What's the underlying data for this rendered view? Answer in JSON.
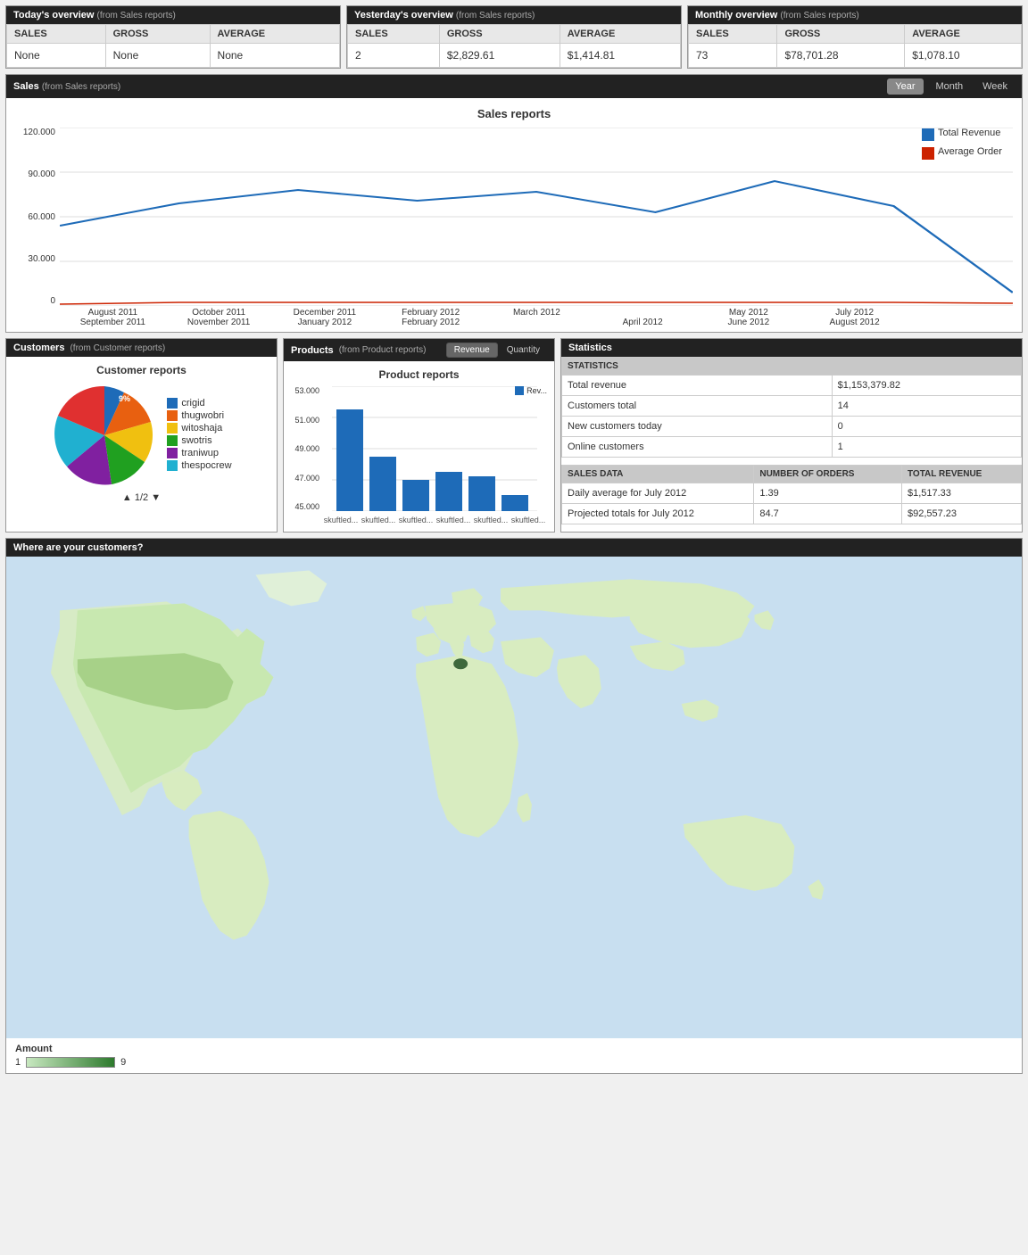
{
  "overviews": [
    {
      "title": "Today's overview",
      "source": "(from Sales reports)",
      "cols": [
        "SALES",
        "GROSS",
        "AVERAGE"
      ],
      "values": [
        "None",
        "None",
        "None"
      ]
    },
    {
      "title": "Yesterday's overview",
      "source": "(from Sales reports)",
      "cols": [
        "SALES",
        "GROSS",
        "AVERAGE"
      ],
      "values": [
        "2",
        "$2,829.61",
        "$1,414.81"
      ]
    },
    {
      "title": "Monthly overview",
      "source": "(from Sales reports)",
      "cols": [
        "SALES",
        "GROSS",
        "AVERAGE"
      ],
      "values": [
        "73",
        "$78,701.28",
        "$1,078.10"
      ]
    }
  ],
  "sales": {
    "title": "Sales",
    "source": "(from Sales reports)",
    "chartTitle": "Sales reports",
    "periods": [
      "Year",
      "Month",
      "Week"
    ],
    "activePeriod": "Year",
    "legend": [
      {
        "label": "Total Revenue",
        "color": "#1e6bb8"
      },
      {
        "label": "Average Order",
        "color": "#cc2200"
      }
    ],
    "xLabels": [
      [
        "August 2011",
        "September 2011"
      ],
      [
        "October 2011",
        "November 2011"
      ],
      [
        "December 2011",
        "January 2012"
      ],
      [
        "February 2012",
        "February 2012"
      ],
      [
        "March 2012",
        ""
      ],
      [
        "April 2012",
        ""
      ],
      [
        "May 2012",
        "June 2012"
      ],
      [
        "July 2012",
        "August 2012"
      ]
    ],
    "yLabels": [
      "120.000",
      "90.000",
      "60.000",
      "30.000",
      "0"
    ]
  },
  "customers": {
    "title": "Customers",
    "source": "(from Customer reports)",
    "chartTitle": "Customer reports",
    "pieData": [
      {
        "label": "crigid",
        "color": "#1e6bb8",
        "pct": 9
      },
      {
        "label": "thugwobri",
        "color": "#e86010"
      },
      {
        "label": "witoshaja",
        "color": "#f0c010"
      },
      {
        "label": "swotris",
        "color": "#20a020"
      },
      {
        "label": "traniwup",
        "color": "#8020a0"
      },
      {
        "label": "thespocrew",
        "color": "#20b0d0"
      }
    ],
    "pageIndicator": "1/2"
  },
  "products": {
    "title": "Products",
    "source": "(from Product reports)",
    "chartTitle": "Product reports",
    "activeView": "Revenue",
    "views": [
      "Revenue",
      "Quantity"
    ],
    "legendLabel": "Rev...",
    "legendColor": "#1e6bb8",
    "yLabels": [
      "53.000",
      "51.000",
      "49.000",
      "47.000",
      "45.000"
    ],
    "bars": [
      {
        "label": "skuftled...",
        "value": 51500
      },
      {
        "label": "skuftled...",
        "value": 48500
      },
      {
        "label": "skuftled...",
        "value": 47000
      },
      {
        "label": "skuftled...",
        "value": 47500
      },
      {
        "label": "skuftled...",
        "value": 47200
      },
      {
        "label": "skuftled...",
        "value": 46000
      }
    ]
  },
  "statistics": {
    "title": "Statistics",
    "sectionLabel": "STATISTICS",
    "rows": [
      {
        "label": "Total revenue",
        "value": "$1,153,379.82"
      },
      {
        "label": "Customers total",
        "value": "14"
      },
      {
        "label": "New customers today",
        "value": "0"
      },
      {
        "label": "Online customers",
        "value": "1"
      }
    ],
    "salesDataHeader": "SALES DATA",
    "salesDataCols": [
      "NUMBER OF ORDERS",
      "TOTAL REVENUE"
    ],
    "salesRows": [
      {
        "label": "Daily average for July 2012",
        "orders": "1.39",
        "revenue": "$1,517.33"
      },
      {
        "label": "Projected totals for July 2012",
        "orders": "84.7",
        "revenue": "$92,557.23"
      }
    ]
  },
  "map": {
    "title": "Where are your customers?",
    "legendLabel": "Amount",
    "legendMin": "1",
    "legendMax": "9"
  }
}
